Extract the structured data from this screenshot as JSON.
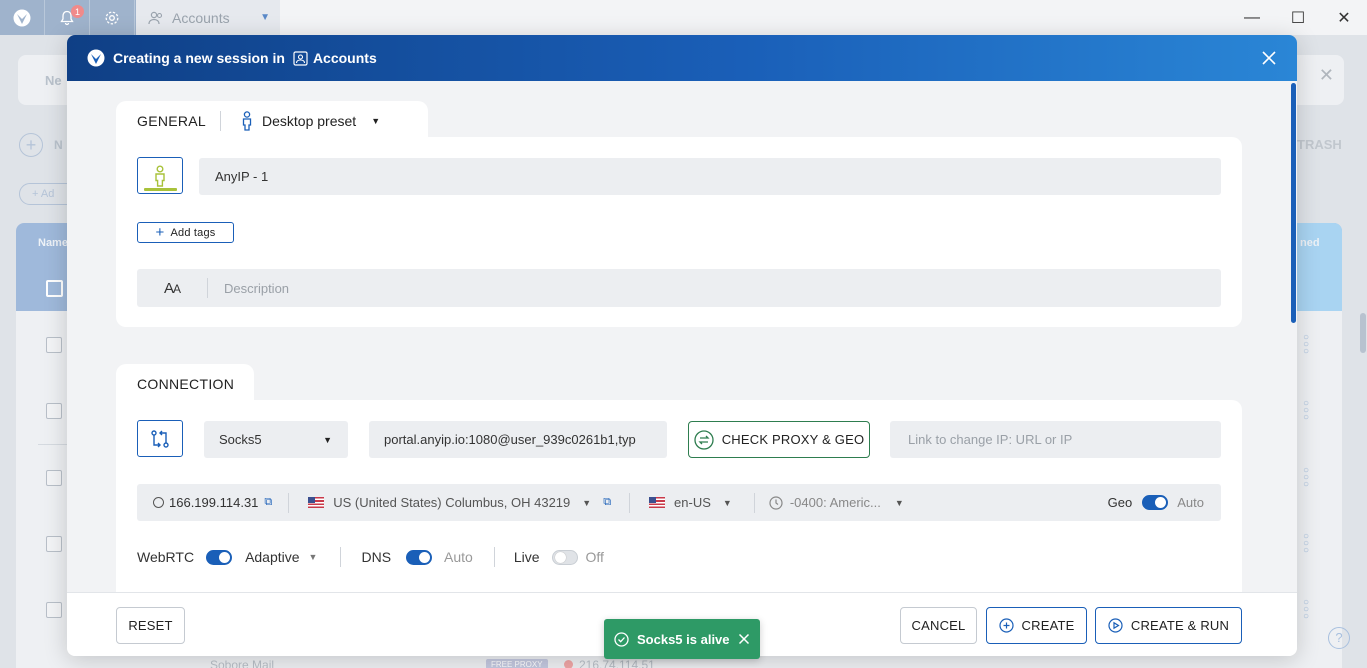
{
  "topbar": {
    "notification_count": "1",
    "tab_label": "Accounts"
  },
  "background": {
    "card_title": "Ne",
    "new_label": "N",
    "trash_label": "TRASH",
    "add_label": "Ad",
    "name_column": "Name",
    "used_column": "ned",
    "bottom_row_name": "Sobore Mail",
    "bottom_row_badge": "FREE PROXY",
    "bottom_row_ip": "216.74.114.51"
  },
  "modal": {
    "title_prefix": "Creating a new session in",
    "workspace": "Accounts",
    "general": {
      "section_title": "GENERAL",
      "preset_label": "Desktop preset",
      "session_name": "AnyIP - 1",
      "add_tags_label": "Add tags",
      "description_placeholder": "Description"
    },
    "connection": {
      "section_title": "CONNECTION",
      "proxy_type": "Socks5",
      "proxy_string": "portal.anyip.io:1080@user_939c0261b1,typ",
      "check_proxy_label": "CHECK PROXY & GEO",
      "change_ip_placeholder": "Link to change IP: URL or IP",
      "ip": "166.199.114.31",
      "location": "US (United States) Columbus, OH 43219",
      "language": "en-US",
      "timezone": "-0400: Americ...",
      "geo_label": "Geo",
      "geo_value": "Auto",
      "webrtc_label": "WebRTC",
      "webrtc_value": "Adaptive",
      "dns_label": "DNS",
      "dns_value": "Auto",
      "live_label": "Live",
      "live_value": "Off"
    },
    "footer": {
      "reset_label": "RESET",
      "cancel_label": "CANCEL",
      "create_label": "CREATE",
      "create_run_label": "CREATE & RUN"
    }
  },
  "toast": {
    "message": "Socks5 is alive"
  },
  "colors": {
    "brand_blue": "#1a5fb8",
    "success_green": "#2e9a66",
    "check_proxy_border": "#2e7d4f"
  }
}
